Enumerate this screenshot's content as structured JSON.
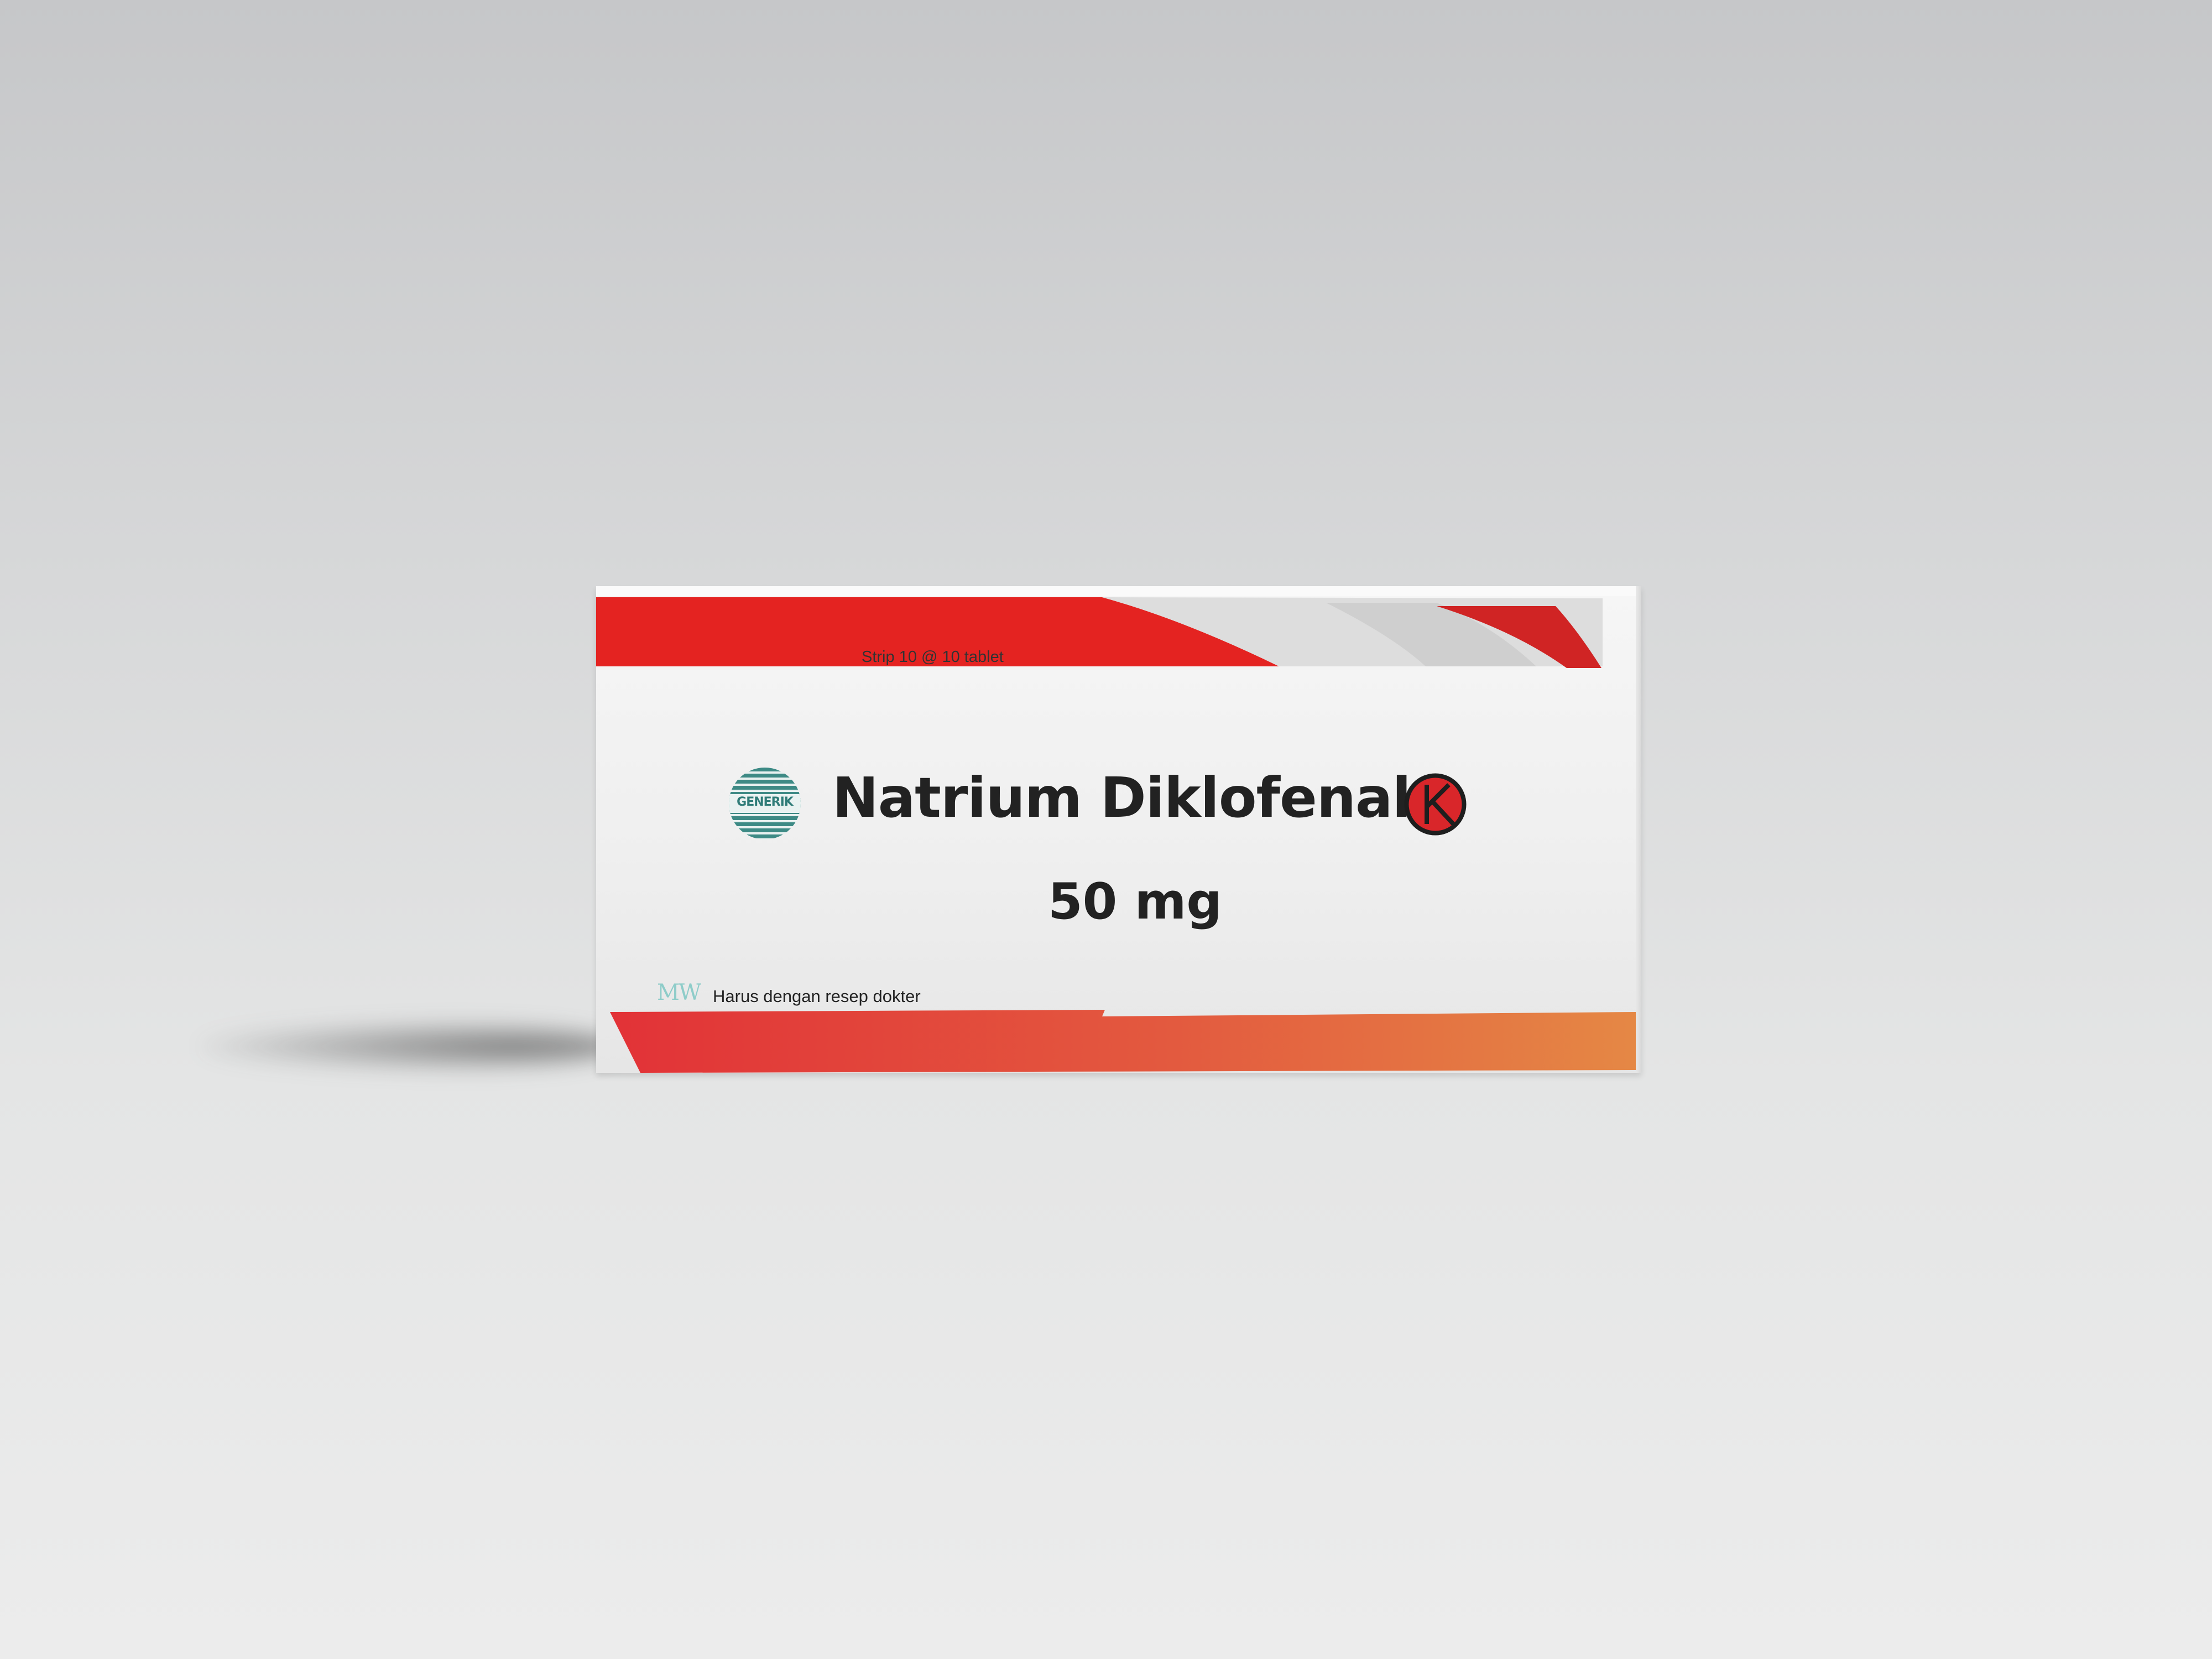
{
  "package": {
    "pack_size": "Strip 10 @ 10 tablet",
    "generik_logo_text": "GENERIK",
    "product_name": "Natrium Diklofenak",
    "strength": "50 mg",
    "prescription_note": "Harus dengan resep dokter",
    "manufacturer_logo_text": "MW",
    "hard_drug_mark": "K"
  },
  "colors": {
    "top_band_red": "#e42321",
    "bottom_band_start": "#e23237",
    "bottom_band_end": "#e58845",
    "generik_teal": "#3d8a85",
    "k_mark_red": "#d9262a"
  },
  "icons": {
    "generik": "generik-logo-icon",
    "k_mark": "hard-drug-k-icon",
    "manufacturer": "mw-logo-icon"
  }
}
